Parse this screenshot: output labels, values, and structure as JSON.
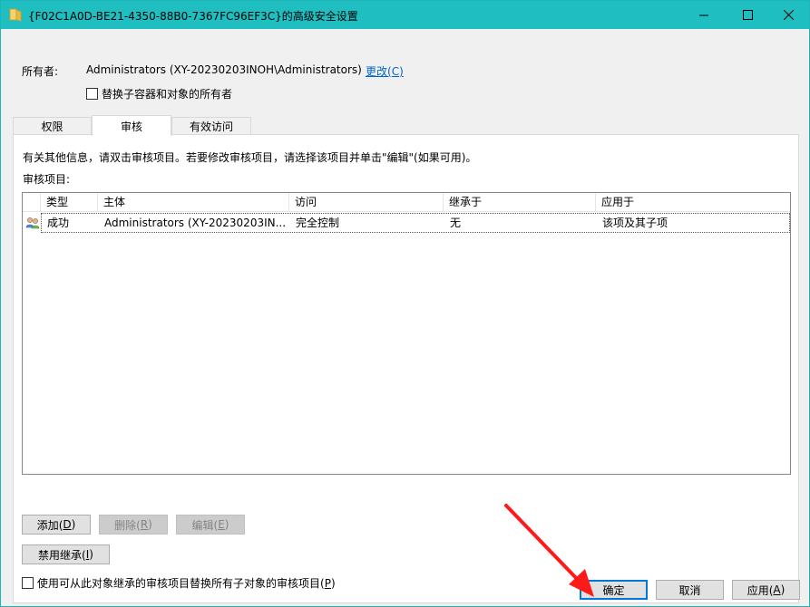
{
  "window": {
    "title": "{F02C1A0D-BE21-4350-88B0-7367FC96EF3C}的高级安全设置",
    "icons": {
      "title": "folder-icon",
      "minimize": "minimize-icon",
      "maximize": "maximize-icon",
      "close": "close-icon"
    }
  },
  "owner": {
    "label": "所有者:",
    "value": "Administrators (XY-20230203INOH\\Administrators)",
    "change_link_prefix": "更改(",
    "change_link_key": "C",
    "change_link_suffix": ")",
    "replace_checkbox": {
      "label": "替换子容器和对象的所有者",
      "checked": false
    }
  },
  "tabs": [
    {
      "label": "权限",
      "active": false
    },
    {
      "label": "审核",
      "active": true
    },
    {
      "label": "有效访问",
      "active": false
    }
  ],
  "audit": {
    "info_text": "有关其他信息，请双击审核项目。若要修改审核项目，请选择该项目并单击\"编辑\"(如果可用)。",
    "entries_label": "审核项目:",
    "columns": [
      "类型",
      "主体",
      "访问",
      "继承于",
      "应用于"
    ],
    "rows": [
      {
        "icon": "users-icon",
        "type": "成功",
        "principal": "Administrators (XY-20230203IN...",
        "access": "完全控制",
        "inherited_from": "无",
        "applies_to": "该项及其子项"
      }
    ]
  },
  "buttons": {
    "add": {
      "label": "添加(",
      "key": "D",
      "suffix": ")"
    },
    "remove": {
      "label": "删除(",
      "key": "R",
      "suffix": ")"
    },
    "edit": {
      "label": "编辑(",
      "key": "E",
      "suffix": ")"
    },
    "disable_inheritance": {
      "label": "禁用继承(",
      "key": "I",
      "suffix": ")"
    }
  },
  "replace_child_checkbox": {
    "label": "使用可从此对象继承的审核项目替换所有子对象的审核项目(",
    "key": "P",
    "suffix": ")",
    "checked": false
  },
  "footer": {
    "ok": "确定",
    "cancel": "取消",
    "apply": {
      "label": "应用(",
      "key": "A",
      "suffix": ")"
    }
  },
  "colors": {
    "titlebar": "#1fbec0",
    "accent": "#0078d7",
    "annotation_arrow": "#ff1a1a",
    "link": "#0066cc"
  }
}
